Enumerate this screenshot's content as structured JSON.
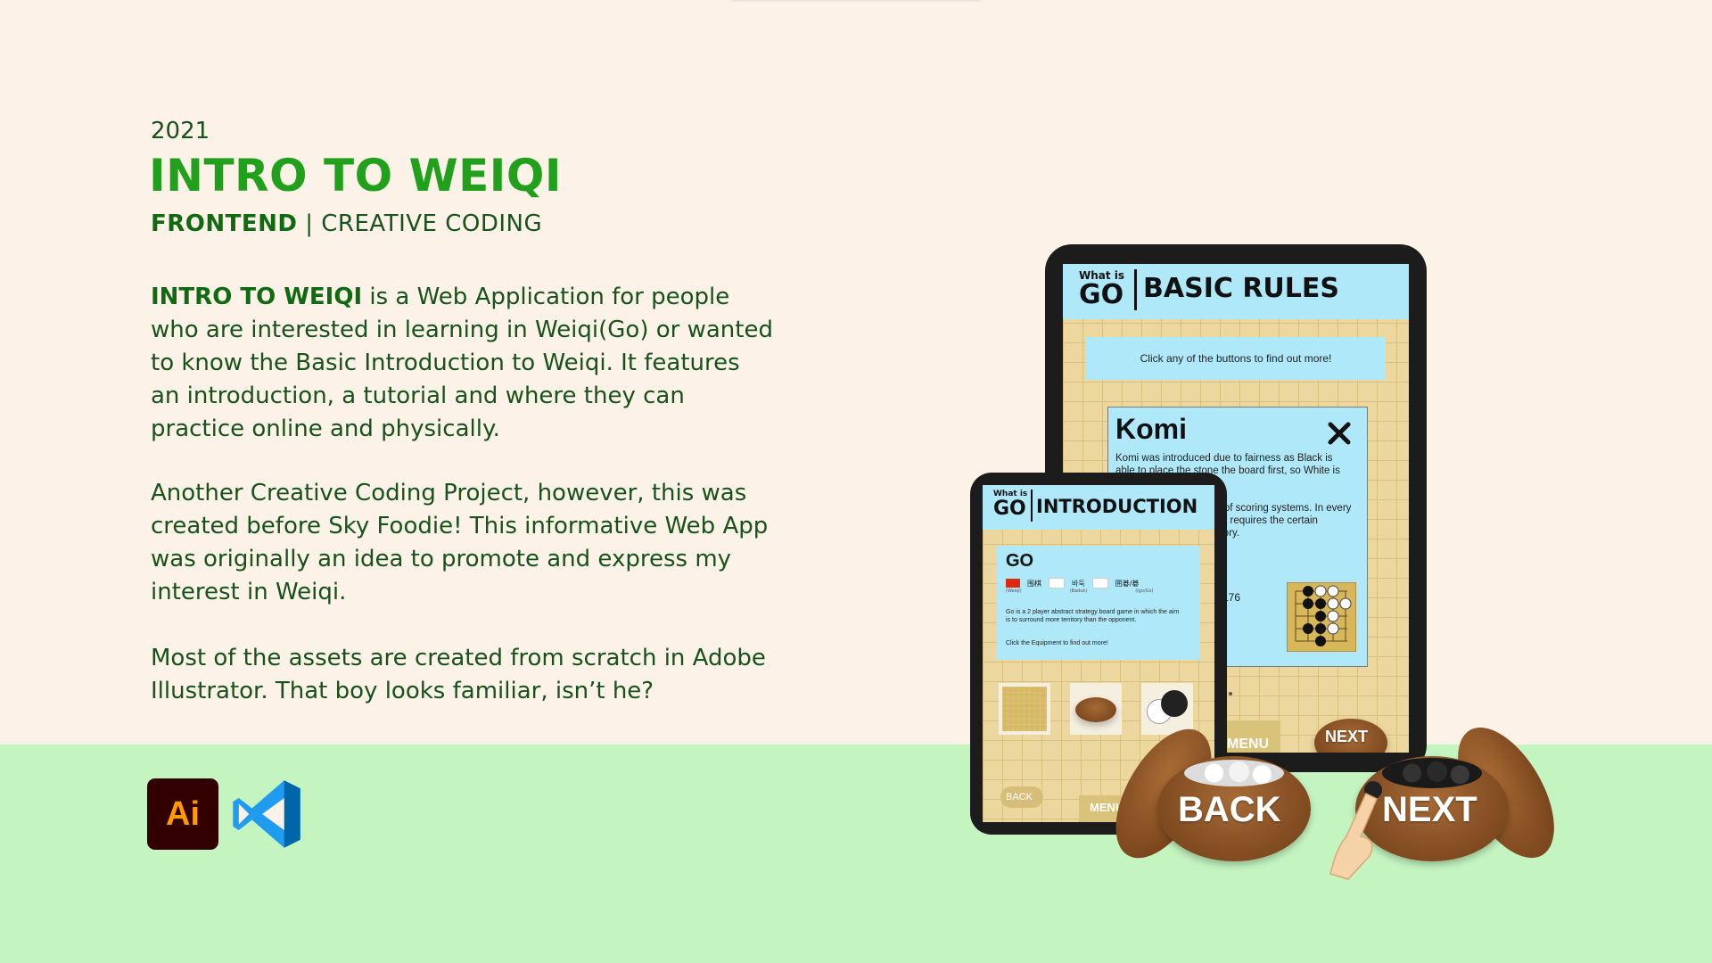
{
  "project": {
    "year": "2021",
    "title": "INTRO TO WEIQI",
    "tag_primary": "FRONTEND",
    "tag_separator": " | ",
    "tag_secondary": "CREATIVE CODING"
  },
  "description": {
    "p1_bold": "INTRO TO WEIQI",
    "p1_rest": " is a Web Application for people who are interested in learning in Weiqi(Go) or wanted to know the Basic Introduction to Weiqi. It features an introduction, a tutorial and where they can practice online and physically.",
    "p2": "Another Creative Coding Project, however, this was created before Sky Foodie! This informative Web App was originally an idea to promote and express my interest in Weiqi.",
    "p3": "Most of the assets are created from scratch in Adobe Illustrator. That boy looks familiar, isn’t he?"
  },
  "tools": {
    "illustrator_text": "Ai",
    "illustrator_icon": "adobe-illustrator-icon",
    "vscode_icon": "vscode-icon"
  },
  "tablet": {
    "header_whatis": "What is",
    "header_go": "GO",
    "header_title": "BASIC RULES",
    "hint": "Click any of the buttons to find out more!",
    "popup_title": "Komi",
    "popup_text_1": "Komi was introduced due to fairness as Black is able to place the stone the board first, so White is one move behind.",
    "popup_text_2": "There are different kind of scoring systems. In every competition the Rule Set requires the certain amount of stone in territory.",
    "popup_number": "176",
    "close_icon": "close-icon",
    "menu_label": "MENU",
    "next_label": "NEXT"
  },
  "phone": {
    "header_whatis": "What is",
    "header_go": "GO",
    "header_title": "INTRODUCTION",
    "card_title": "GO",
    "lang_cn": "围棋",
    "lang_cn_sub": "(Weiqi)",
    "lang_kr": "바둑",
    "lang_kr_sub": "(Baduk)",
    "lang_jp": "囲碁/碁",
    "lang_jp_sub": "(Igo/Go)",
    "card_text": "Go is a 2 player abstract strategy board game in which the aim is to surround more territory than the opponent.",
    "card_hint": "Click the Equipment to find out more!",
    "back_label": "BACK",
    "menu_label": "MENU"
  },
  "bowls": {
    "back_label": "BACK",
    "next_label": "NEXT"
  },
  "colors": {
    "background": "#fdf2e8",
    "bottom_band": "#c4f5c1",
    "title_green": "#21a01c",
    "text_green": "#18521b",
    "screen_header": "#aee8f9",
    "board": "#ecd79e"
  }
}
